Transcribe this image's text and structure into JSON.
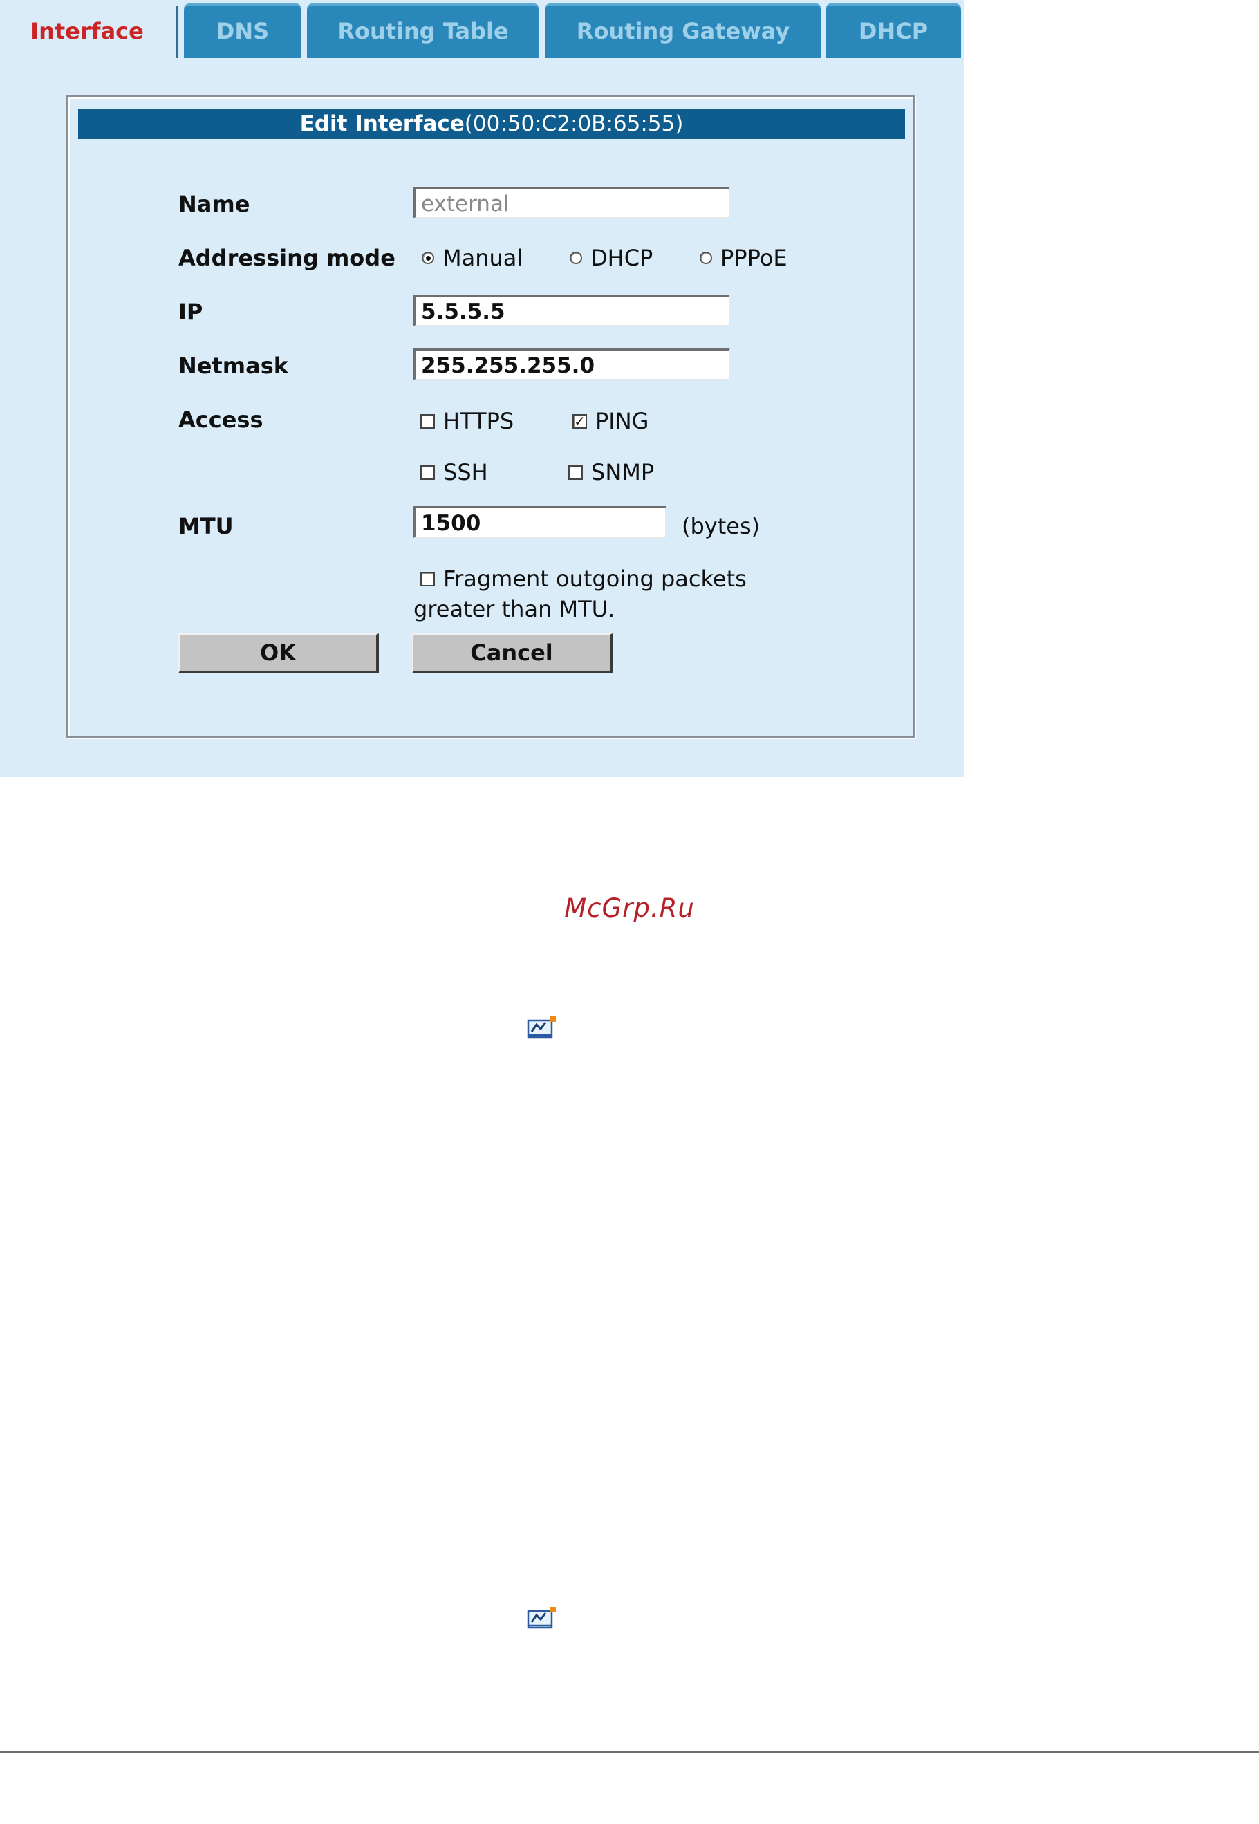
{
  "tabs": [
    {
      "label": "Interface",
      "active": true
    },
    {
      "label": "DNS",
      "active": false
    },
    {
      "label": "Routing Table",
      "active": false
    },
    {
      "label": "Routing Gateway",
      "active": false
    },
    {
      "label": "DHCP",
      "active": false
    }
  ],
  "dialog": {
    "title_bold": "Edit Interface",
    "title_mac": "(00:50:C2:0B:65:55)"
  },
  "form": {
    "name": {
      "label": "Name",
      "value": "external",
      "disabled": true
    },
    "addressing_mode": {
      "label": "Addressing mode",
      "options": [
        {
          "label": "Manual",
          "selected": true
        },
        {
          "label": "DHCP",
          "selected": false
        },
        {
          "label": "PPPoE",
          "selected": false
        }
      ]
    },
    "ip": {
      "label": "IP",
      "value": "5.5.5.5"
    },
    "netmask": {
      "label": "Netmask",
      "value": "255.255.255.0"
    },
    "access": {
      "label": "Access",
      "options": [
        {
          "label": "HTTPS",
          "checked": false
        },
        {
          "label": "PING",
          "checked": true
        },
        {
          "label": "SSH",
          "checked": false
        },
        {
          "label": "SNMP",
          "checked": false
        }
      ]
    },
    "mtu": {
      "label": "MTU",
      "value": "1500",
      "unit": "(bytes)"
    },
    "fragment": {
      "line1": "Fragment outgoing packets",
      "line2": "greater than MTU.",
      "checked": false
    },
    "ok_label": "OK",
    "cancel_label": "Cancel"
  },
  "page": {
    "watermark": "McGrp.Ru",
    "icons": [
      "note-icon",
      "note-icon"
    ]
  },
  "colors": {
    "panel_bg": "#d9ecf8",
    "tab_bg": "#2a87b9",
    "active_tab_text": "#cc2424",
    "title_bar": "#0f5c8e",
    "watermark": "#b5202a"
  }
}
